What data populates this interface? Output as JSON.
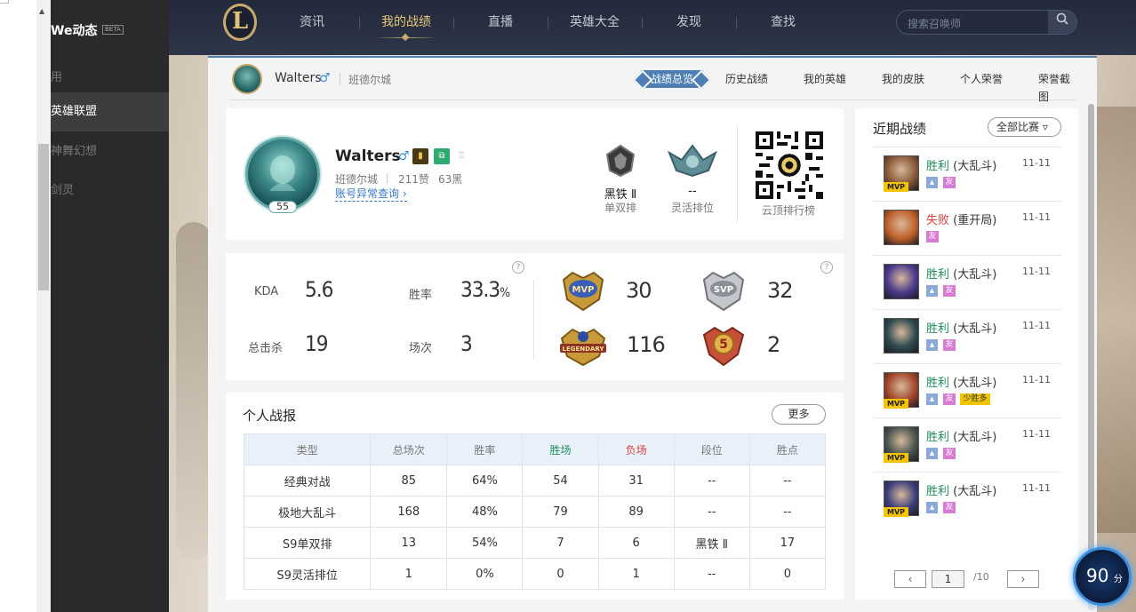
{
  "sidebar": {
    "title": "We动态",
    "beta": "BETA",
    "items": [
      {
        "label": "用"
      },
      {
        "label": "英雄联盟"
      },
      {
        "label": "神舞幻想"
      },
      {
        "label": "剑灵"
      }
    ]
  },
  "topnav": {
    "logo": "L",
    "items": [
      "资讯",
      "我的战绩",
      "直播",
      "英雄大全",
      "发现",
      "查找"
    ],
    "active": "我的战绩",
    "search_placeholder": "搜索召唤师"
  },
  "profile_bar": {
    "name": "Walters",
    "gender": "♂",
    "region": "班德尔城",
    "tabs": [
      "战绩总览",
      "历史战绩",
      "我的英雄",
      "我的皮肤",
      "个人荣誉",
      "荣誉截图"
    ],
    "active_tab": "战绩总览"
  },
  "profile_card": {
    "name": "Walters",
    "gender": "♂",
    "level": "55",
    "region": "班德尔城",
    "likes": "211赞",
    "dislikes": "63黑",
    "abnormal_link": "账号异常查询 ›",
    "ranks": [
      {
        "tier": "黑铁 Ⅱ",
        "queue": "单双排"
      },
      {
        "tier": "--",
        "queue": "灵活排位"
      }
    ],
    "qr_label": "云顶排行榜"
  },
  "stats": {
    "kda_label": "KDA",
    "kda": "5.6",
    "winrate_label": "胜率",
    "winrate": "33.3",
    "winrate_unit": "%",
    "kills_label": "总击杀",
    "kills": "19",
    "games_label": "场次",
    "games": "3",
    "help": "?",
    "medals": [
      {
        "name": "MVP",
        "count": "30"
      },
      {
        "name": "SVP",
        "count": "32"
      },
      {
        "name": "LEGENDARY",
        "count": "116"
      },
      {
        "name": "5",
        "count": "2"
      }
    ]
  },
  "report": {
    "title": "个人战报",
    "more": "更多",
    "headers": [
      "类型",
      "总场次",
      "胜率",
      "胜场",
      "负场",
      "段位",
      "胜点"
    ],
    "rows": [
      [
        "经典对战",
        "85",
        "64%",
        "54",
        "31",
        "--",
        "--"
      ],
      [
        "极地大乱斗",
        "168",
        "48%",
        "79",
        "89",
        "--",
        "--"
      ],
      [
        "S9单双排",
        "13",
        "54%",
        "7",
        "6",
        "黑铁 Ⅱ",
        "17"
      ],
      [
        "S9灵活排位",
        "1",
        "0%",
        "0",
        "1",
        "--",
        "0"
      ]
    ]
  },
  "recent": {
    "title": "近期战绩",
    "filter": "全部比赛 ▿",
    "matches": [
      {
        "result": "胜利",
        "mode": "(大乱斗)",
        "date": "11-11",
        "mvp": "MVP",
        "tags": [
          "img",
          "友"
        ],
        "champ_color": "#8a5a3a"
      },
      {
        "result": "失败",
        "mode": "(重开局)",
        "date": "11-11",
        "mvp": "",
        "tags": [
          "友"
        ],
        "champ_color": "#c0612a"
      },
      {
        "result": "胜利",
        "mode": "(大乱斗)",
        "date": "11-11",
        "mvp": "",
        "tags": [
          "img",
          "友"
        ],
        "champ_color": "#4b3a8c"
      },
      {
        "result": "胜利",
        "mode": "(大乱斗)",
        "date": "11-11",
        "mvp": "",
        "tags": [
          "img",
          "友"
        ],
        "champ_color": "#2f4a4f"
      },
      {
        "result": "胜利",
        "mode": "(大乱斗)",
        "date": "11-11",
        "mvp": "MVP",
        "tags": [
          "img",
          "友",
          "少胜多"
        ],
        "champ_color": "#a3462a"
      },
      {
        "result": "胜利",
        "mode": "(大乱斗)",
        "date": "11-11",
        "mvp": "MVP",
        "tags": [
          "img",
          "友"
        ],
        "champ_color": "#4a5550"
      },
      {
        "result": "胜利",
        "mode": "(大乱斗)",
        "date": "11-11",
        "mvp": "MVP",
        "tags": [
          "img",
          "友"
        ],
        "champ_color": "#3b3f7a"
      }
    ],
    "pager": {
      "prev": "‹",
      "current": "1",
      "total": "/10",
      "next": "›"
    }
  },
  "score_widget": {
    "value": "90",
    "unit": "分"
  }
}
